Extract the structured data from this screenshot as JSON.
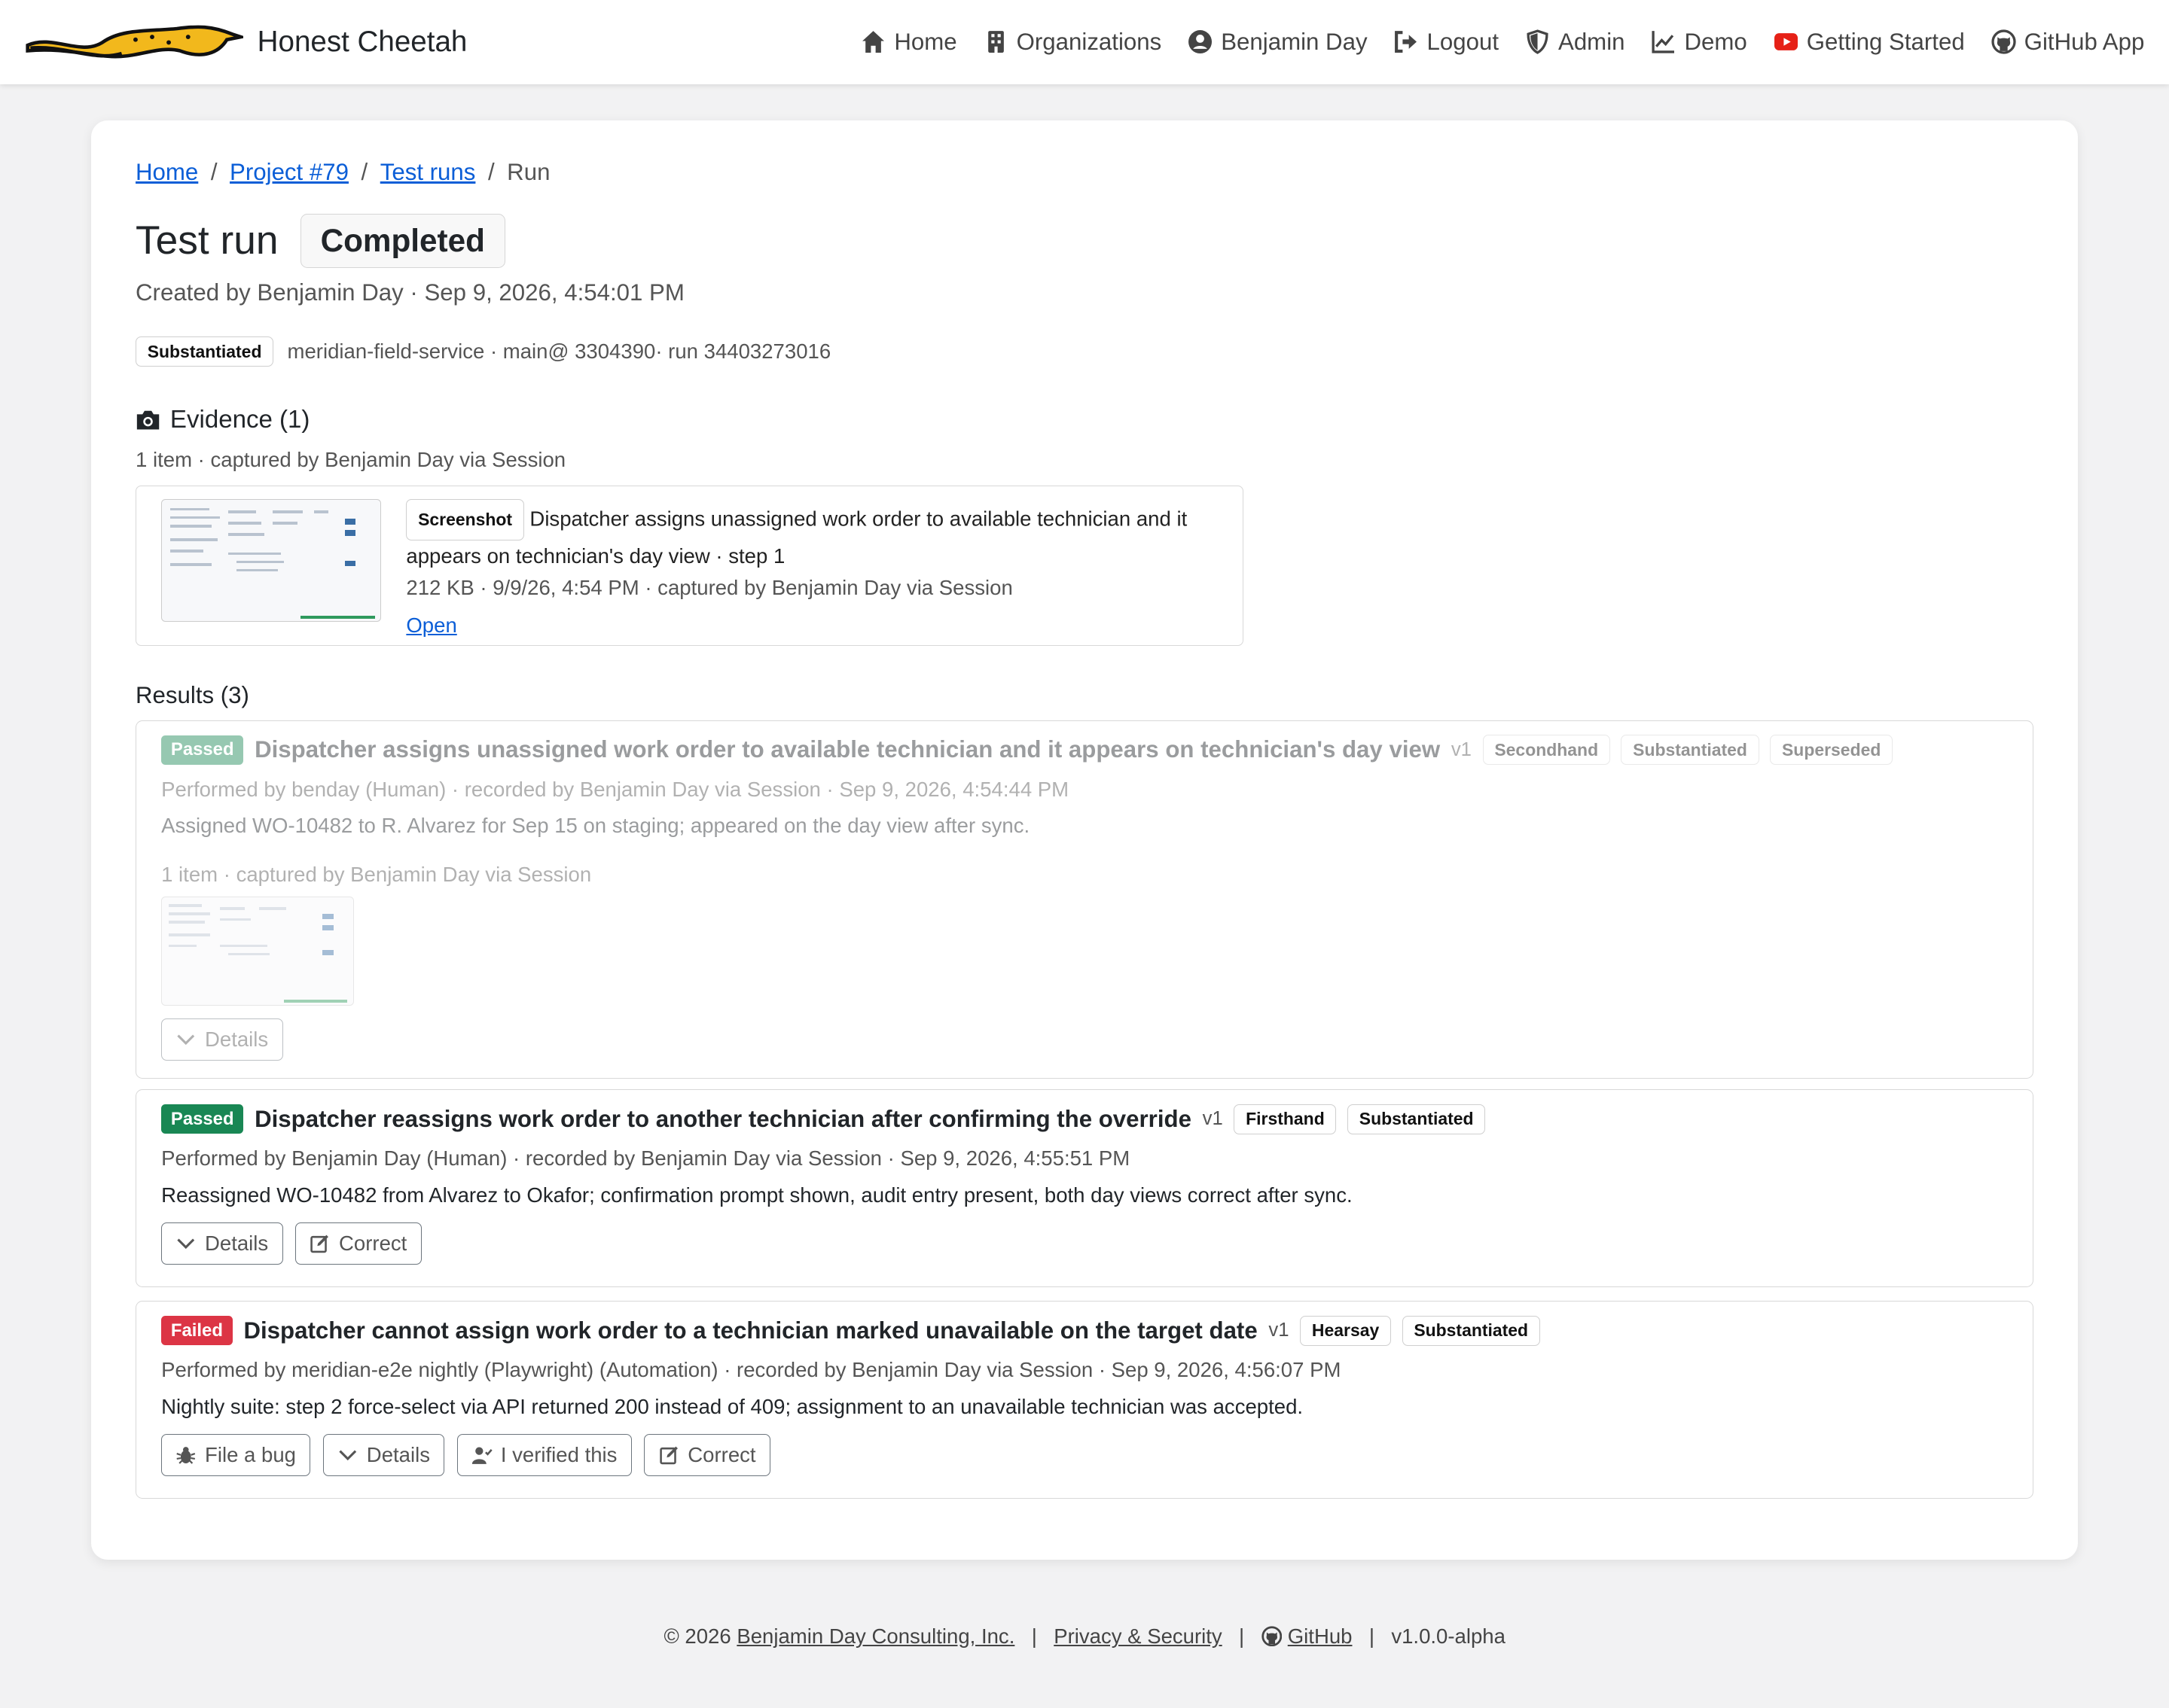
{
  "brand": {
    "name": "Honest Cheetah"
  },
  "nav": {
    "items": [
      {
        "label": "Home",
        "icon": "house-icon"
      },
      {
        "label": "Organizations",
        "icon": "building-icon"
      },
      {
        "label": "Benjamin Day",
        "icon": "user-circle-icon"
      },
      {
        "label": "Logout",
        "icon": "logout-icon"
      },
      {
        "label": "Admin",
        "icon": "shield-icon"
      },
      {
        "label": "Demo",
        "icon": "chart-icon"
      },
      {
        "label": "Getting Started",
        "icon": "youtube-icon"
      },
      {
        "label": "GitHub App",
        "icon": "github-icon"
      }
    ]
  },
  "breadcrumb": {
    "home": "Home",
    "project": "Project #79",
    "runs": "Test runs",
    "current": "Run",
    "sep": "/"
  },
  "page": {
    "title": "Test run",
    "status": "Completed",
    "created": "Created by Benjamin Day · Sep 9, 2026, 4:54:01 PM",
    "tag": "Substantiated",
    "source": "meridian-field-service · main@ 3304390· run 34403273016"
  },
  "evidence": {
    "title": "Evidence (1)",
    "summary": "1 item · captured by Benjamin Day via Session",
    "item": {
      "type": "Screenshot",
      "description": "Dispatcher assigns unassigned work order to available technician and it appears on technician's day view · step 1",
      "meta": "212 KB · 9/9/26, 4:54 PM · captured by Benjamin Day via Session",
      "open": "Open"
    }
  },
  "results": {
    "title": "Results (3)",
    "items": [
      {
        "status": "Passed",
        "title": "Dispatcher assigns unassigned work order to available technician and it appears on technician's day view",
        "version": "v1",
        "tags": [
          "Secondhand",
          "Substantiated",
          "Superseded"
        ],
        "meta": "Performed by benday (Human) · recorded by Benjamin Day via Session · Sep 9, 2026, 4:54:44 PM",
        "note": "Assigned WO-10482 to R. Alvarez for Sep 15 on staging; appeared on the day view after sync.",
        "evidence": "1 item · captured by Benjamin Day via Session",
        "details": "Details"
      },
      {
        "status": "Passed",
        "title": "Dispatcher reassigns work order to another technician after confirming the override",
        "version": "v1",
        "tags": [
          "Firsthand",
          "Substantiated"
        ],
        "meta": "Performed by Benjamin Day (Human) · recorded by Benjamin Day via Session · Sep 9, 2026, 4:55:51 PM",
        "note": "Reassigned WO-10482 from Alvarez to Okafor; confirmation prompt shown, audit entry present, both day views correct after sync.",
        "details": "Details",
        "correct": "Correct"
      },
      {
        "status": "Failed",
        "title": "Dispatcher cannot assign work order to a technician marked unavailable on the target date",
        "version": "v1",
        "tags": [
          "Hearsay",
          "Substantiated"
        ],
        "meta": "Performed by meridian-e2e nightly (Playwright) (Automation) · recorded by Benjamin Day via Session · Sep 9, 2026, 4:56:07 PM",
        "note": "Nightly suite: step 2 force-select via API returned 200 instead of 409; assignment to an unavailable technician was accepted.",
        "file_bug": "File a bug",
        "details": "Details",
        "verified": "I verified this",
        "correct": "Correct"
      }
    ]
  },
  "footer": {
    "copyright": "© 2026",
    "company": "Benjamin Day Consulting, Inc.",
    "privacy": "Privacy & Security",
    "github": "GitHub",
    "version": "v1.0.0-alpha",
    "sep": "|"
  },
  "colors": {
    "passed": "#198754",
    "failed": "#dc3545",
    "link": "#0b5ed7",
    "youtube": "#e62117",
    "logo": "#f2b81c"
  }
}
